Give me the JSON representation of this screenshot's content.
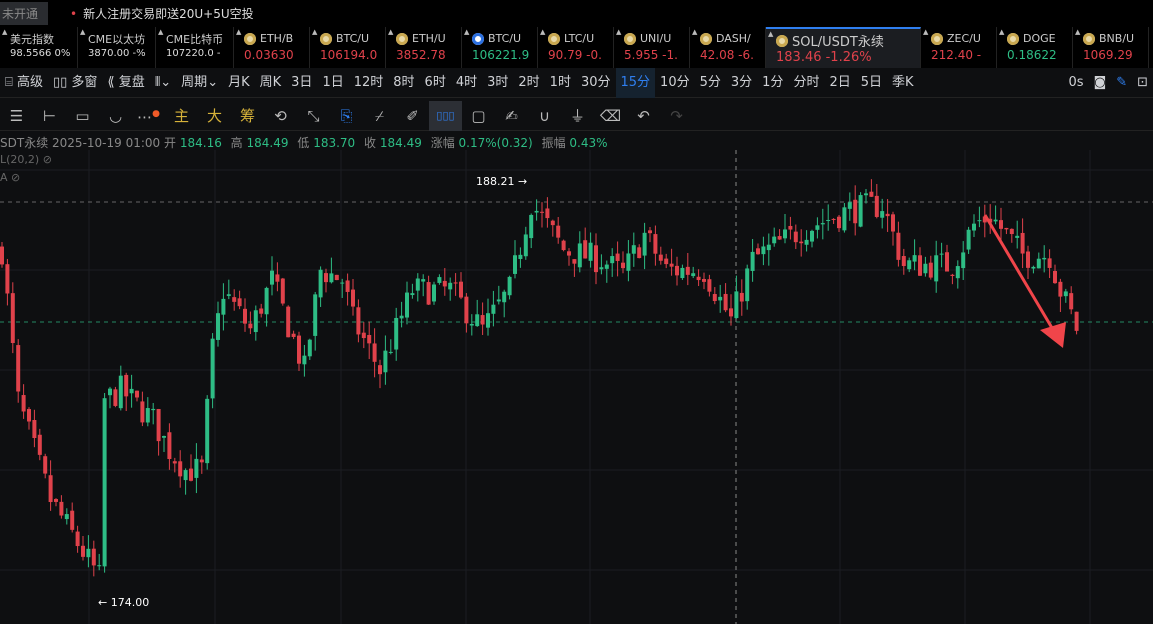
{
  "news": {
    "tag": "未开通",
    "text": "新人注册交易即送20U+5U空投"
  },
  "tickers": [
    {
      "name": "美元指数",
      "value": "98.5566  0%",
      "kind": "small"
    },
    {
      "name": "CME以太坊",
      "value": "3870.00  -%",
      "kind": "small"
    },
    {
      "name": "CME比特币",
      "value": "107220.0  -",
      "kind": "small"
    },
    {
      "name": "ETH/B",
      "value": "0.03630",
      "color": "red",
      "coin": "gold"
    },
    {
      "name": "BTC/U",
      "value": "106194.0",
      "color": "red",
      "coin": "gold"
    },
    {
      "name": "ETH/U",
      "value": "3852.78",
      "color": "red",
      "coin": "gold"
    },
    {
      "name": "BTC/U",
      "value": "106221.9",
      "color": "green",
      "coin": "blue"
    },
    {
      "name": "LTC/U",
      "value": "90.79  -0.",
      "color": "red",
      "coin": "gold"
    },
    {
      "name": "UNI/U",
      "value": "5.955  -1.",
      "color": "red",
      "coin": "gold"
    },
    {
      "name": "DASH/",
      "value": "42.08  -6.",
      "color": "red",
      "coin": "gold"
    },
    {
      "name": "SOL/USDT永续",
      "value": "183.46  -1.26%",
      "color": "red",
      "coin": "gold",
      "active": true
    },
    {
      "name": "ZEC/U",
      "value": "212.40  -",
      "color": "red",
      "coin": "gold"
    },
    {
      "name": "DOGE",
      "value": "0.18622",
      "color": "green",
      "coin": "gold"
    },
    {
      "name": "BNB/U",
      "value": "1069.29",
      "color": "red",
      "coin": "gold"
    }
  ],
  "toolbar": {
    "advanced": "高级",
    "multi": "多窗",
    "replay": "复盘",
    "period": "周期",
    "periods": [
      "月K",
      "周K",
      "3日",
      "1日",
      "12时",
      "8时",
      "6时",
      "4时",
      "3时",
      "2时",
      "1时",
      "30分",
      "15分",
      "10分",
      "5分",
      "3分",
      "1分",
      "分时",
      "2日",
      "5日",
      "季K"
    ],
    "active_period": "15分",
    "countdown": "0s"
  },
  "drawtools": {
    "main": "主",
    "big": "大",
    "chips": "筹"
  },
  "info": {
    "symbol": "SDT永续",
    "time": "2025-10-19 01:00",
    "open_l": "开",
    "open": "184.16",
    "high_l": "高",
    "high": "184.49",
    "low_l": "低",
    "low": "183.70",
    "close_l": "收",
    "close": "184.49",
    "chg_l": "涨幅",
    "chg": "0.17%(0.32)",
    "amp_l": "振幅",
    "amp": "0.43%"
  },
  "indicators": [
    "L(20,2)",
    "A"
  ],
  "chart_data": {
    "type": "candlestick",
    "max_label": "188.21",
    "min_label": "174.00",
    "ylim": [
      172.2,
      190.6
    ],
    "current_price": 183.46,
    "path": [
      [
        0,
        186.4
      ],
      [
        3,
        180.7
      ],
      [
        9,
        176.95
      ],
      [
        18,
        174.0
      ],
      [
        19,
        180.7
      ],
      [
        22,
        181.1
      ],
      [
        28,
        179.97
      ],
      [
        31,
        178.84
      ],
      [
        34,
        178.08
      ],
      [
        37,
        178.08
      ],
      [
        39,
        182.62
      ],
      [
        41,
        184.88
      ],
      [
        46,
        183.37
      ],
      [
        50,
        185.26
      ],
      [
        56,
        181.86
      ],
      [
        59,
        185.64
      ],
      [
        63,
        185.26
      ],
      [
        65,
        183.75
      ],
      [
        70,
        181.86
      ],
      [
        76,
        184.88
      ],
      [
        83,
        184.88
      ],
      [
        89,
        183.37
      ],
      [
        94,
        184.88
      ],
      [
        98,
        188.21
      ],
      [
        104,
        186.4
      ],
      [
        111,
        186.02
      ],
      [
        115,
        185.5
      ],
      [
        119,
        186.96
      ],
      [
        123,
        185.64
      ],
      [
        130,
        185.64
      ],
      [
        135,
        183.75
      ],
      [
        139,
        186.02
      ],
      [
        148,
        187.15
      ],
      [
        157,
        187.91
      ],
      [
        163,
        188.1
      ],
      [
        167,
        185.83
      ],
      [
        176,
        185.83
      ],
      [
        180,
        187.34
      ],
      [
        183,
        187.72
      ],
      [
        189,
        186.21
      ],
      [
        194,
        186.21
      ],
      [
        196,
        184.88
      ],
      [
        199,
        183.46
      ]
    ]
  }
}
